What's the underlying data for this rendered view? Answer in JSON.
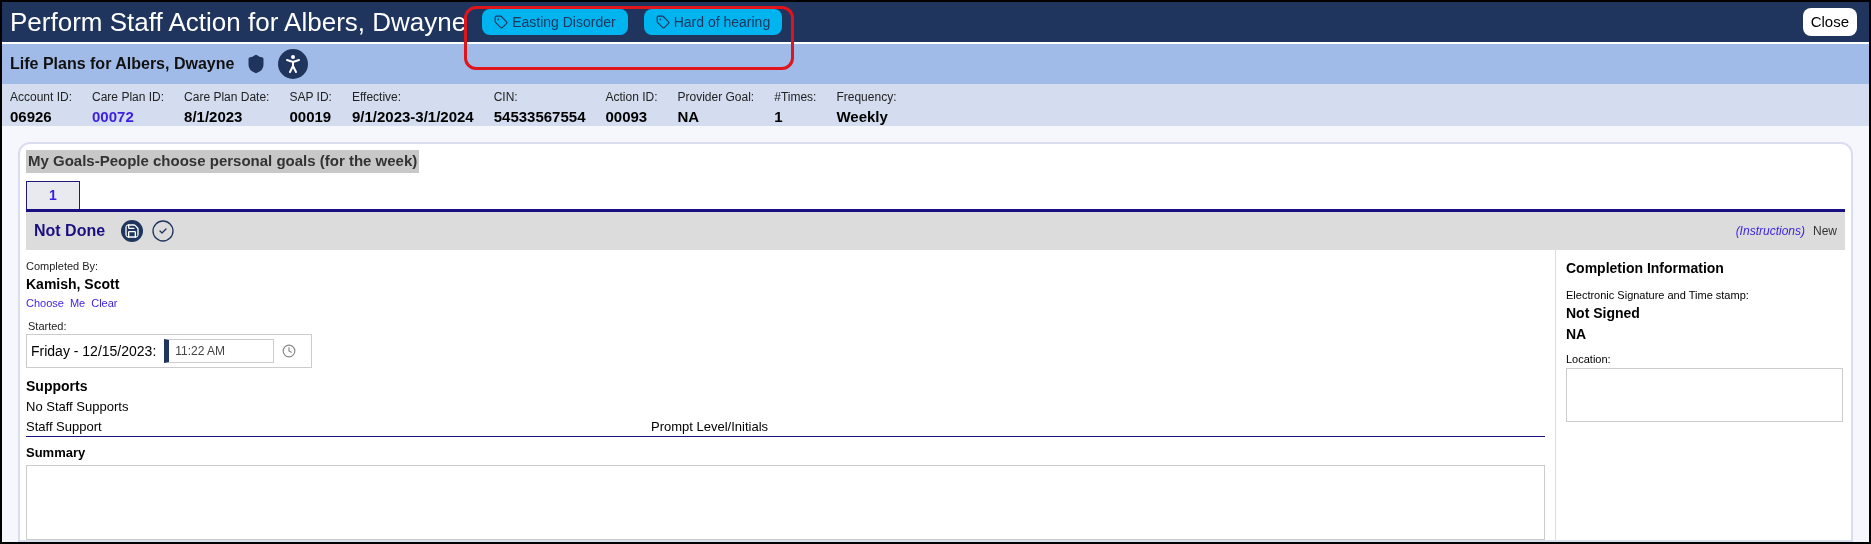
{
  "window": {
    "title": "Perform Staff Action for Albers, Dwayne",
    "close_label": "Close"
  },
  "tags": [
    {
      "label": "Easting Disorder"
    },
    {
      "label": "Hard of hearing"
    }
  ],
  "subheader": {
    "title": "Life Plans for Albers, Dwayne"
  },
  "info_fields": [
    {
      "label": "Account ID:",
      "value": "06926",
      "link": false
    },
    {
      "label": "Care Plan ID:",
      "value": "00072",
      "link": true
    },
    {
      "label": "Care Plan Date:",
      "value": "8/1/2023",
      "link": false
    },
    {
      "label": "SAP ID:",
      "value": "00019",
      "link": false
    },
    {
      "label": "Effective:",
      "value": "9/1/2023-3/1/2024",
      "link": false
    },
    {
      "label": "CIN:",
      "value": "54533567554",
      "link": false
    },
    {
      "label": "Action ID:",
      "value": "00093",
      "link": false
    },
    {
      "label": "Provider Goal:",
      "value": "NA",
      "link": false
    },
    {
      "label": "#Times:",
      "value": "1",
      "link": false
    },
    {
      "label": "Frequency:",
      "value": "Weekly",
      "link": false
    }
  ],
  "section": {
    "title": "My Goals-People choose personal goals (for the week)",
    "tabs": [
      {
        "label": "1",
        "selected": true
      }
    ],
    "status": "Not Done",
    "instructions_link": "(Instructions)",
    "new_label": "New"
  },
  "completed_by": {
    "label": "Completed By:",
    "name": "Kamish, Scott",
    "links": [
      "Choose",
      "Me",
      "Clear"
    ]
  },
  "started": {
    "label": "Started:",
    "date": "Friday - 12/15/2023:",
    "time": "11:22 AM"
  },
  "supports": {
    "title": "Supports",
    "empty_text": "No Staff Supports",
    "columns": [
      "Staff Support",
      "Prompt Level/Initials"
    ]
  },
  "summary": {
    "title": "Summary"
  },
  "completion": {
    "title": "Completion Information",
    "signature_label": "Electronic Signature and Time stamp:",
    "signature_status": "Not Signed",
    "signature_value": "NA",
    "location_label": "Location:"
  }
}
